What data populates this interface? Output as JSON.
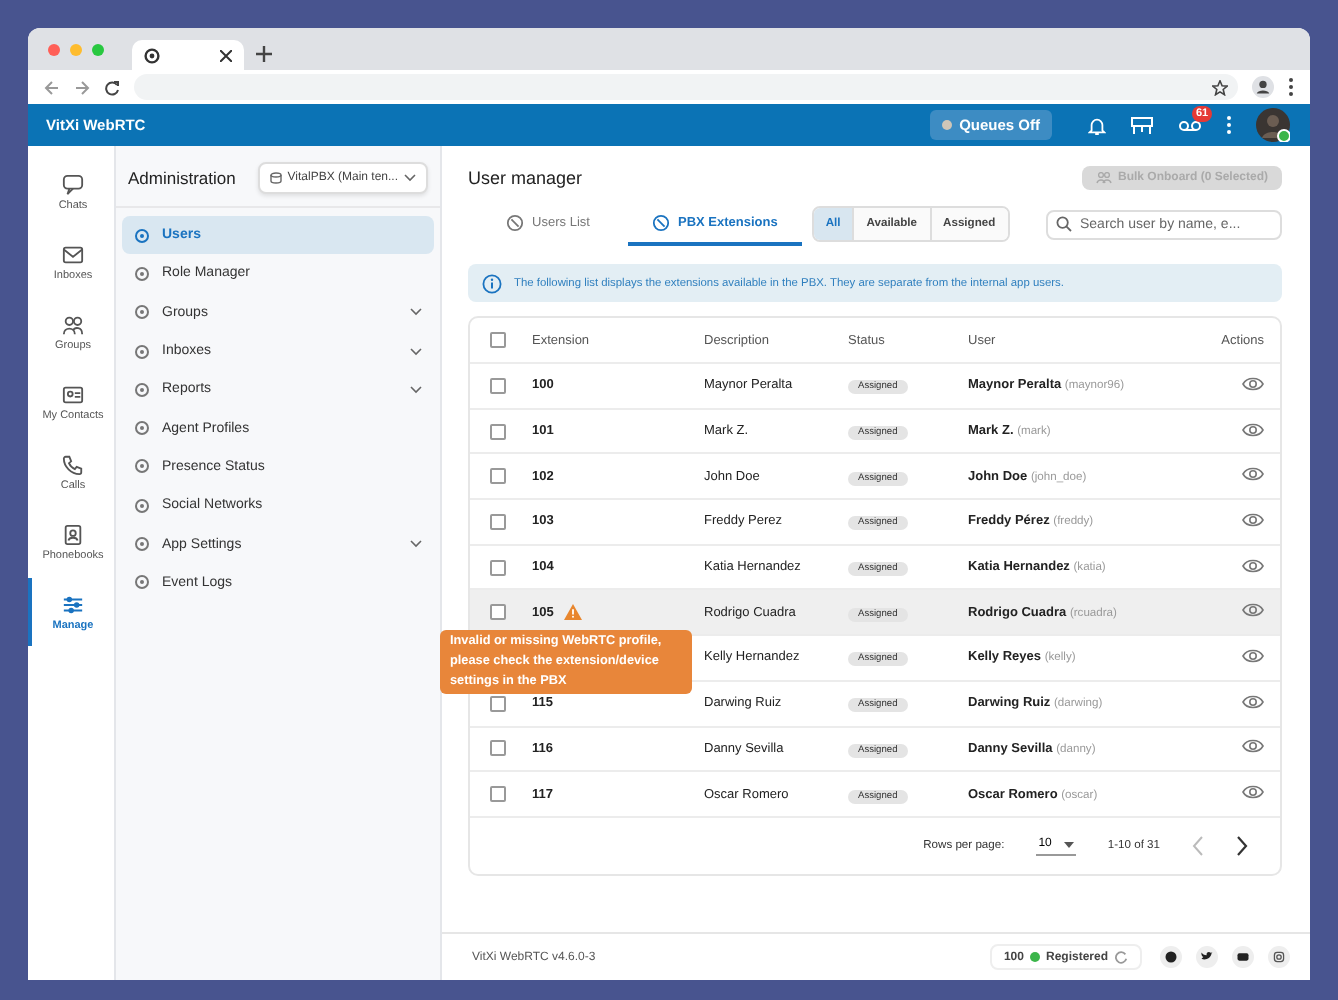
{
  "app": {
    "title": "VitXi WebRTC",
    "queues_button": "Queues Off",
    "voicemail_badge": "61"
  },
  "rail": [
    {
      "label": "Chats",
      "selected": false
    },
    {
      "label": "Inboxes",
      "selected": false
    },
    {
      "label": "Groups",
      "selected": false
    },
    {
      "label": "My Contacts",
      "selected": false
    },
    {
      "label": "Calls",
      "selected": false
    },
    {
      "label": "Phonebooks",
      "selected": false
    },
    {
      "label": "Manage",
      "selected": true
    }
  ],
  "admin": {
    "title": "Administration",
    "tenant": "VitalPBX (Main ten...",
    "items": [
      {
        "label": "Users",
        "expandable": false,
        "selected": true
      },
      {
        "label": "Role Manager",
        "expandable": false,
        "selected": false
      },
      {
        "label": "Groups",
        "expandable": true,
        "selected": false
      },
      {
        "label": "Inboxes",
        "expandable": true,
        "selected": false
      },
      {
        "label": "Reports",
        "expandable": true,
        "selected": false
      },
      {
        "label": "Agent Profiles",
        "expandable": false,
        "selected": false
      },
      {
        "label": "Presence Status",
        "expandable": false,
        "selected": false
      },
      {
        "label": "Social Networks",
        "expandable": false,
        "selected": false
      },
      {
        "label": "App Settings",
        "expandable": true,
        "selected": false
      },
      {
        "label": "Event Logs",
        "expandable": false,
        "selected": false
      }
    ]
  },
  "main": {
    "title": "User manager",
    "bulk_button": {
      "label": "Bulk Onboard (0 Selected)",
      "disabled": true
    },
    "tabs": [
      {
        "label": "Users List",
        "selected": false
      },
      {
        "label": "PBX Extensions",
        "selected": true
      }
    ],
    "filters": [
      {
        "label": "All",
        "selected": true
      },
      {
        "label": "Available",
        "selected": false
      },
      {
        "label": "Assigned",
        "selected": false
      }
    ],
    "search": {
      "placeholder": "Search user by name, e..."
    },
    "info": "The following list displays the extensions available in the PBX. They are separate from the internal app users.",
    "table": {
      "select_all_checked": false,
      "columns": [
        "Extension",
        "Description",
        "Status",
        "User",
        "Actions"
      ],
      "rows": [
        {
          "extension": "100",
          "description": "Maynor Peralta",
          "status": "Assigned",
          "user": "Maynor Peralta",
          "username": "(maynor96)",
          "checked": false,
          "warning": false,
          "highlighted": false
        },
        {
          "extension": "101",
          "description": "Mark Z.",
          "status": "Assigned",
          "user": "Mark Z.",
          "username": "(mark)",
          "checked": false,
          "warning": false,
          "highlighted": false
        },
        {
          "extension": "102",
          "description": "John Doe",
          "status": "Assigned",
          "user": "John Doe",
          "username": "(john_doe)",
          "checked": false,
          "warning": false,
          "highlighted": false
        },
        {
          "extension": "103",
          "description": "Freddy Perez",
          "status": "Assigned",
          "user": "Freddy Pérez",
          "username": "(freddy)",
          "checked": false,
          "warning": false,
          "highlighted": false
        },
        {
          "extension": "104",
          "description": "Katia Hernandez",
          "status": "Assigned",
          "user": "Katia Hernandez",
          "username": "(katia)",
          "checked": false,
          "warning": false,
          "highlighted": false
        },
        {
          "extension": "105",
          "description": "Rodrigo Cuadra",
          "status": "Assigned",
          "user": "Rodrigo Cuadra",
          "username": "(rcuadra)",
          "checked": false,
          "warning": true,
          "highlighted": true
        },
        {
          "description": "Kelly Hernandez",
          "status": "Assigned",
          "user": "Kelly Reyes",
          "username": "(kelly)",
          "warning": false,
          "highlighted": false
        },
        {
          "extension": "115",
          "description": "Darwing Ruiz",
          "status": "Assigned",
          "user": "Darwing Ruiz",
          "username": "(darwing)",
          "checked": false,
          "warning": false,
          "highlighted": false
        },
        {
          "extension": "116",
          "description": "Danny Sevilla",
          "status": "Assigned",
          "user": "Danny Sevilla",
          "username": "(danny)",
          "checked": false,
          "warning": false,
          "highlighted": false
        },
        {
          "extension": "117",
          "description": "Oscar Romero",
          "status": "Assigned",
          "user": "Oscar Romero",
          "username": "(oscar)",
          "checked": false,
          "warning": false,
          "highlighted": false
        }
      ],
      "tooltip": "Invalid or missing WebRTC profile, please check the extension/device settings in the PBX",
      "pagination": {
        "rows_label": "Rows per page:",
        "rows_value": "10",
        "range": "1-10 of 31"
      }
    }
  },
  "footer": {
    "version": "VitXi WebRTC v4.6.0-3",
    "extension": "100",
    "status": "Registered"
  }
}
